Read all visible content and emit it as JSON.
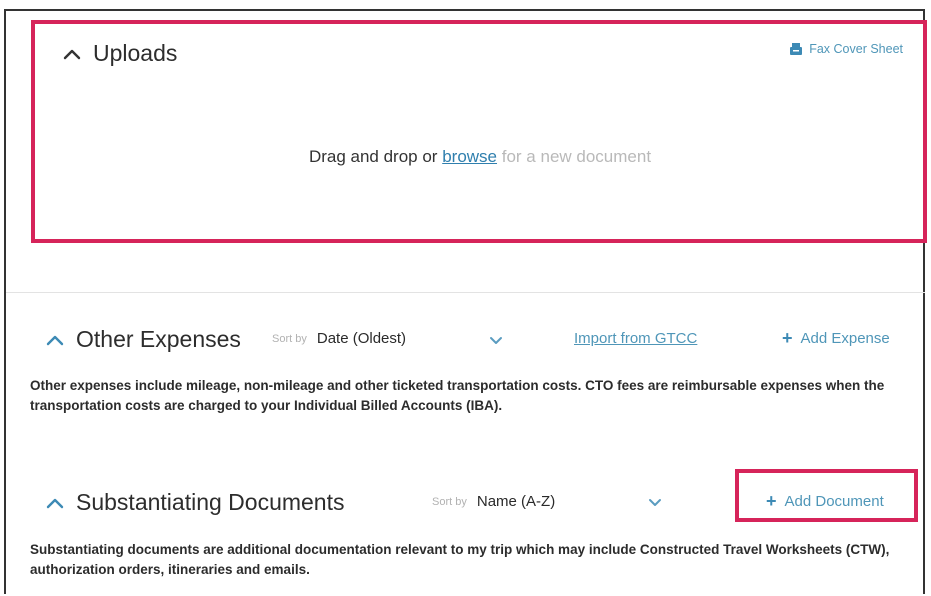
{
  "uploads": {
    "title": "Uploads",
    "fax_cover_label": "Fax Cover Sheet",
    "drop_prefix": "Drag and drop or",
    "browse_label": "browse",
    "drop_suffix": "for a new document"
  },
  "other_expenses": {
    "title": "Other Expenses",
    "sort_label": "Sort by",
    "sort_value": "Date (Oldest)",
    "import_label": "Import from GTCC",
    "add_label": "Add Expense",
    "description": "Other expenses include mileage, non-mileage and other ticketed transportation costs. CTO fees are reimbursable expenses when the transportation costs are charged to your Individual Billed Accounts (IBA)."
  },
  "substantiating_documents": {
    "title": "Substantiating Documents",
    "sort_label": "Sort by",
    "sort_value": "Name (A-Z)",
    "add_label": "Add Document",
    "description": "Substantiating documents are additional documentation relevant to my trip which may include Constructed Travel Worksheets (CTW), authorization orders, itineraries and emails."
  },
  "colors": {
    "highlight": "#d6245a",
    "link": "#2f7fae",
    "accent": "#4f96b8"
  },
  "icons": {
    "collapse": "chevron-up-icon",
    "sort_dropdown": "chevron-down-icon",
    "fax": "fax-icon",
    "add": "plus-icon"
  }
}
